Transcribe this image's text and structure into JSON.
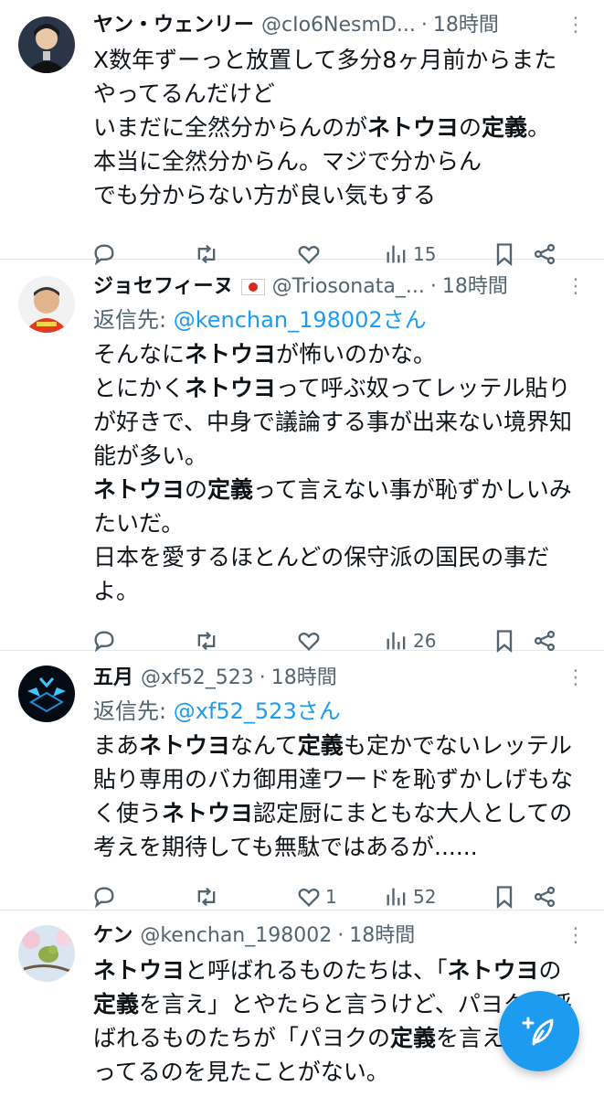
{
  "tweets": [
    {
      "name": "ヤン・ウェンリー",
      "handle": "@cIo6NesmD...",
      "time": "18時間",
      "lines": [
        [
          {
            "t": "X数年ずーっと放置して多分8ヶ月前からまた"
          }
        ],
        [
          {
            "t": "やってるんだけど"
          }
        ],
        [
          {
            "t": "いまだに全然分からんのが"
          },
          {
            "t": "ネトウヨ",
            "b": true
          },
          {
            "t": "の"
          },
          {
            "t": "定義",
            "b": true
          },
          {
            "t": "。"
          }
        ],
        [
          {
            "t": "本当に全然分からん。マジで分からん"
          }
        ],
        [
          {
            "t": "でも分からない方が良い気もする"
          }
        ]
      ],
      "views": "15"
    },
    {
      "name": "ジョセフィーヌ",
      "handle": "@Triosonata_...",
      "time": "18時間",
      "reply_label": "返信先: ",
      "reply_to": "@kenchan_198002さん",
      "lines": [
        [
          {
            "t": "そんなに"
          },
          {
            "t": "ネトウヨ",
            "b": true
          },
          {
            "t": "が怖いのかな。"
          }
        ],
        [
          {
            "t": "とにかく"
          },
          {
            "t": "ネトウヨ",
            "b": true
          },
          {
            "t": "って呼ぶ奴ってレッテル貼り"
          }
        ],
        [
          {
            "t": "が好きで、中身で議論する事が出来ない境界知"
          }
        ],
        [
          {
            "t": "能が多い。"
          }
        ],
        [
          {
            "t": "ネトウヨ",
            "b": true
          },
          {
            "t": "の"
          },
          {
            "t": "定義",
            "b": true
          },
          {
            "t": "って言えない事が恥ずかしいみ"
          }
        ],
        [
          {
            "t": "たいだ。"
          }
        ],
        [
          {
            "t": "日本を愛するほとんどの保守派の国民の事だ"
          }
        ],
        [
          {
            "t": "よ。"
          }
        ]
      ],
      "views": "26"
    },
    {
      "name": "五月",
      "handle": "@xf52_523",
      "time": "18時間",
      "reply_label": "返信先: ",
      "reply_to": "@xf52_523さん",
      "lines": [
        [
          {
            "t": "まあ"
          },
          {
            "t": "ネトウヨ",
            "b": true
          },
          {
            "t": "なんて"
          },
          {
            "t": "定義",
            "b": true
          },
          {
            "t": "も定かでないレッテル"
          }
        ],
        [
          {
            "t": "貼り専用のバカ御用達ワードを恥ずかしげもな"
          }
        ],
        [
          {
            "t": "く使う"
          },
          {
            "t": "ネトウヨ",
            "b": true
          },
          {
            "t": "認定厨にまともな大人としての"
          }
        ],
        [
          {
            "t": "考えを期待しても無駄ではあるが......"
          }
        ]
      ],
      "likes": "1",
      "views": "52"
    },
    {
      "name": "ケン",
      "handle": "@kenchan_198002",
      "time": "18時間",
      "lines": [
        [
          {
            "t": "ネトウヨ",
            "b": true
          },
          {
            "t": "と呼ばれるものたちは、「"
          },
          {
            "t": "ネトウヨ",
            "b": true
          },
          {
            "t": "の"
          }
        ],
        [
          {
            "t": "定義",
            "b": true
          },
          {
            "t": "を言え」とやたらと言うけど、パヨクと呼"
          }
        ],
        [
          {
            "t": "ばれるものたちが「パヨクの"
          },
          {
            "t": "定義",
            "b": true
          },
          {
            "t": "を言え」と言"
          }
        ],
        [
          {
            "t": "ってるのを見たことがない。"
          }
        ]
      ]
    }
  ],
  "colors": {
    "accent": "#1d9bf0",
    "muted": "#536471",
    "divider": "#e5e9ec",
    "flag_red": "#d52b1e"
  },
  "icons": [
    "reply-icon",
    "retweet-icon",
    "like-icon",
    "views-icon",
    "bookmark-icon",
    "share-icon",
    "more-icon",
    "compose-icon"
  ]
}
